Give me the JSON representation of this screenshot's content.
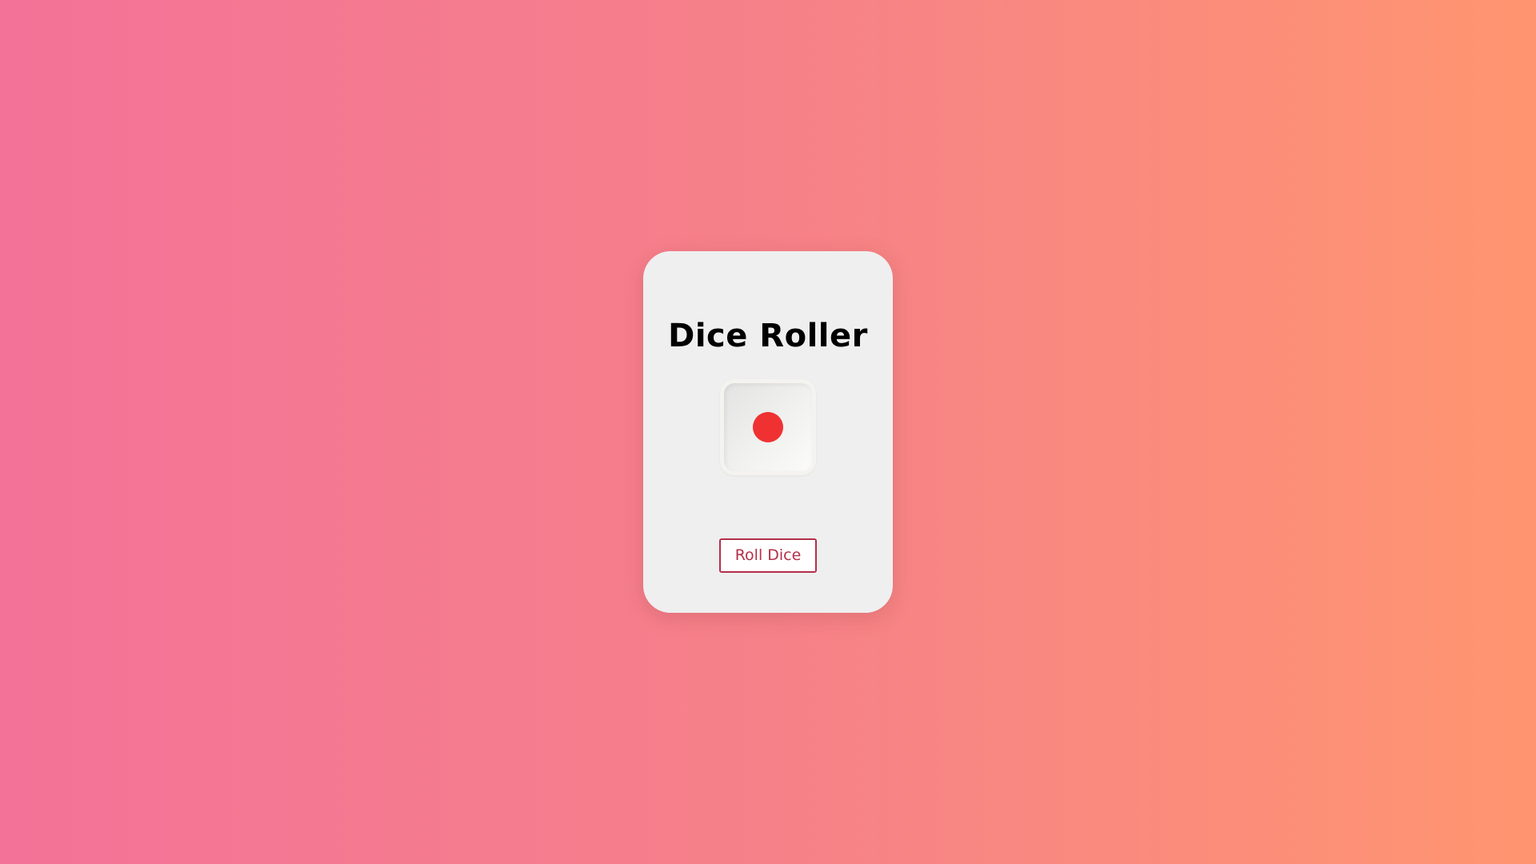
{
  "app": {
    "title": "Dice Roller"
  },
  "die": {
    "face_value": 1,
    "pip_icon": "dot-icon",
    "pip_color": "#f03132"
  },
  "controls": {
    "roll_label": "Roll Dice",
    "accent_color": "#b3304a"
  },
  "theme": {
    "background_gradient": [
      "#f37298",
      "#ff9570"
    ],
    "card_color": "#efefef"
  }
}
